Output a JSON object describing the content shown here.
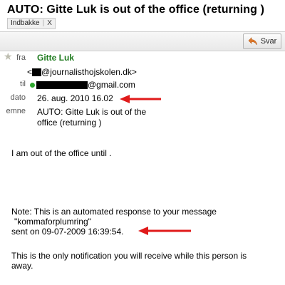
{
  "message": {
    "subject": "AUTO: Gitte Luk is out of the office (returning )",
    "label": "Indbakke",
    "label_close": "X"
  },
  "toolbar": {
    "reply_label": "Svar",
    "reply_icon": "reply-arrow-icon"
  },
  "header": {
    "from_label": "fra",
    "from_name": "Gitte Luk",
    "from_email_open": "<",
    "from_email_domain": "@journalisthojskolen.dk>",
    "to_label": "til",
    "to_email_domain": "@gmail.com",
    "date_label": "dato",
    "date_value": "26. aug. 2010 16.02",
    "subject_label": "emne",
    "subject_value": "AUTO: Gitte Luk is out of the office (returning )"
  },
  "body": {
    "line1": "I am out of the office until .",
    "note1": "Note: This is an automated response to your message",
    "note2": "\"kommaforplumring\"",
    "note3": "sent on 09-07-2009 16:39:54.",
    "only1": "This is the only notification you will receive while this person is",
    "only2": "away."
  },
  "colors": {
    "sender_name": "#1e7a1e",
    "arrow": "#e01a1a",
    "online": "#2fa82f"
  }
}
